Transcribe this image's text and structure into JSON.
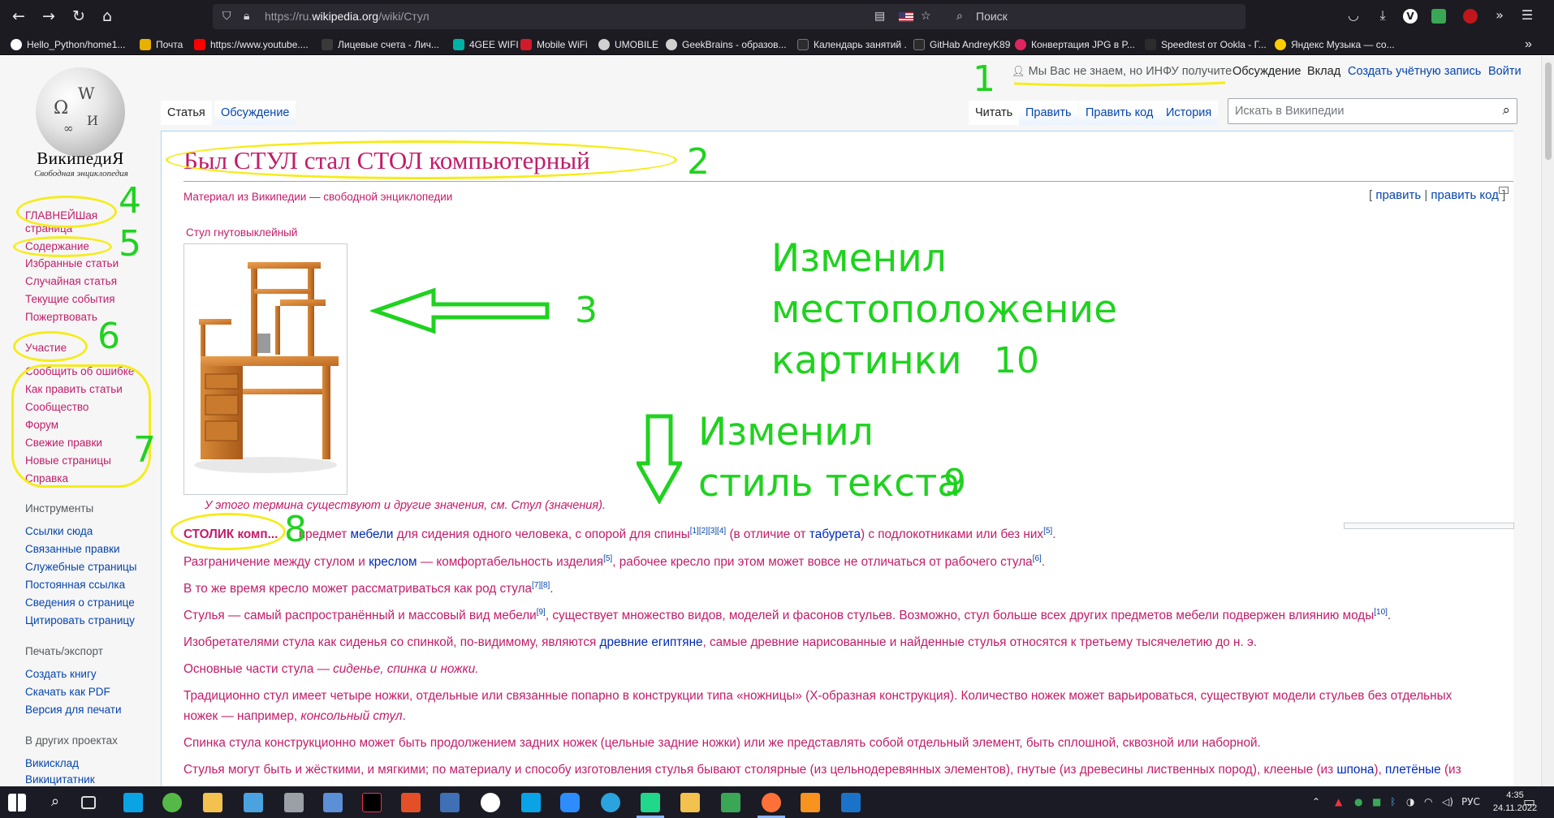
{
  "browser": {
    "url_prefix": "https://ru.",
    "url_domain": "wikipedia.org",
    "url_path": "/wiki/Стул",
    "search_placeholder": "Поиск",
    "nav": {
      "back": "←",
      "forward": "→",
      "reload": "↻",
      "home": "⌂"
    }
  },
  "bookmarks": [
    {
      "label": "Hello_Python/home1...",
      "color": "#ffffff"
    },
    {
      "label": "Почта",
      "color": "#e8b000"
    },
    {
      "label": "https://www.youtube....",
      "color": "#ff0000"
    },
    {
      "label": "Лицевые счета - Лич...",
      "color": "#3a3a3a"
    },
    {
      "label": "4GEE WIFI",
      "color": "#00b3a4"
    },
    {
      "label": "Mobile WiFi",
      "color": "#d11a2a"
    },
    {
      "label": "UMOBILE",
      "color": "#d0d0d0"
    },
    {
      "label": "GeekBrains - образов...",
      "color": "#d0d0d0"
    },
    {
      "label": "Календарь занятий .",
      "color": "#2c2c2c"
    },
    {
      "label": "GitHab AndreyK89",
      "color": "#2c2c2c"
    },
    {
      "label": "Конвертация JPG в P...",
      "color": "#e0245e"
    },
    {
      "label": "Speedtest от Ookla - Г...",
      "color": "#2c2c2c"
    },
    {
      "label": "Яндекс Музыка — со...",
      "color": "#ffcc00"
    }
  ],
  "wiki": {
    "wordmark": "ВикипедиЯ",
    "tagline": "Свободная энциклопедия",
    "nav_main": "ГЛАВНЕЙШая",
    "nav_main_cont": "страница",
    "nav_links": [
      "Содержание",
      "Избранные статьи",
      "Случайная статья",
      "Текущие события",
      "Пожертвовать"
    ],
    "participation_head": "Участие",
    "participation_links": [
      "Сообщить об ошибке",
      "Как править статьи",
      "Сообщество",
      "Форум",
      "Свежие правки",
      "Новые страницы",
      "Справка"
    ],
    "tools_head": "Инструменты",
    "tools_links": [
      "Ссылки сюда",
      "Связанные правки",
      "Служебные страницы",
      "Постоянная ссылка",
      "Сведения о странице",
      "Цитировать страницу"
    ],
    "print_head": "Печать/экспорт",
    "print_links": [
      "Создать книгу",
      "Скачать как PDF",
      "Версия для печати"
    ],
    "projects_head": "В других проектах",
    "projects_links": [
      "Викисклад",
      "Викицитатник"
    ],
    "personal": {
      "notice": "Мы Вас не знаем, но ИНФУ получите",
      "talk": "Обсуждение",
      "contrib": "Вклад",
      "create": "Создать учётную запись",
      "login": "Войти"
    },
    "tabs_left": [
      "Статья",
      "Обсуждение"
    ],
    "tabs_right": [
      "Читать",
      "Править",
      "Править код",
      "История"
    ],
    "search_placeholder": "Искать в Википедии",
    "title": "Был СТУЛ стал СТОЛ компьютерный",
    "subtitle": "Материал из Википедии — свободной энциклопедии",
    "edit": "править",
    "edit_code": "править код",
    "image_caption": "Стул гнутовыклейный",
    "hatnote_pre": "У этого термина существуют и другие значения, см.",
    "hatnote_link": "Стул (значения)",
    "lead_bold": "СТОЛИК комп...",
    "lead_rest_1": "предмет",
    "lead_link_1": "мебели",
    "lead_rest_2": "для сидения одного человека, с опорой для спины",
    "lead_refs_1": "[1][2][3][4]",
    "lead_rest_3": "(в отличие от",
    "lead_link_2": "табурета",
    "lead_rest_4": ") с подлокотниками или без них",
    "lead_refs_2": "[5]",
    "p2_a": "Разграничение между стулом и",
    "p2_link": "креслом",
    "p2_b": "— комфортабельность изделия",
    "p2_r1": "[5]",
    "p2_c": ", рабочее кресло при этом может вовсе не отличаться от рабочего стула",
    "p2_r2": "[6]",
    "p3_a": "В то же время кресло может рассматриваться как род стула",
    "p3_r": "[7][8]",
    "p4_a": "Стулья — самый распространённый и массовый вид мебели",
    "p4_r1": "[9]",
    "p4_b": ", существует множество видов, моделей и фасонов стульев. Возможно, стул больше всех других предметов мебели подвержен влиянию моды",
    "p4_r2": "[10]",
    "p5_a": "Изобретателями стула как сиденья со спинкой, по-видимому, являются",
    "p5_link": "древние египтяне",
    "p5_b": ", самые древние нарисованные и найденные стулья относятся к третьему тысячелетию до н. э.",
    "p6_a": "Основные части стула —",
    "p6_it": "сиденье, спинка и ножки.",
    "p7_line1": "Традиционно стул имеет четыре ножки, отдельные или связанные попарно в конструкции типа «ножницы» (Х-образная конструкция). Количество ножек может варьироваться, существуют модели стульев без отдельных",
    "p7_line2_a": "ножек — например,",
    "p7_line2_it": "консольный стул",
    "p8": "Спинка стула конструкционно может быть продолжением задних ножек (цельные задние ножки) или же представлять собой отдельный элемент, быть сплошной, сквозной или наборной.",
    "p9_a": "Стулья могут быть и жёсткими, и мягкими; по материалу и способу изготовления стулья бывают столярные (из цельнодеревянных элементов), гнутые (из древесины лиственных пород), клееные (из",
    "p9_link1": "шпона",
    "p9_b": "),",
    "p9_link2": "плетёные",
    "p9_c": "(из"
  },
  "annotations": {
    "n1": "1",
    "n2": "2",
    "n3": "3",
    "n4": "4",
    "n5": "5",
    "n6": "6",
    "n7": "7",
    "n8": "8",
    "n9": "9",
    "n10": "10",
    "text_place_1": "Изменил",
    "text_place_2": "местоположение",
    "text_place_3": "картинки",
    "text_style_1": "Изменил",
    "text_style_2": "стиль текста"
  },
  "taskbar": {
    "lang": "РУС",
    "time": "4:35",
    "date": "24.11.2022"
  }
}
